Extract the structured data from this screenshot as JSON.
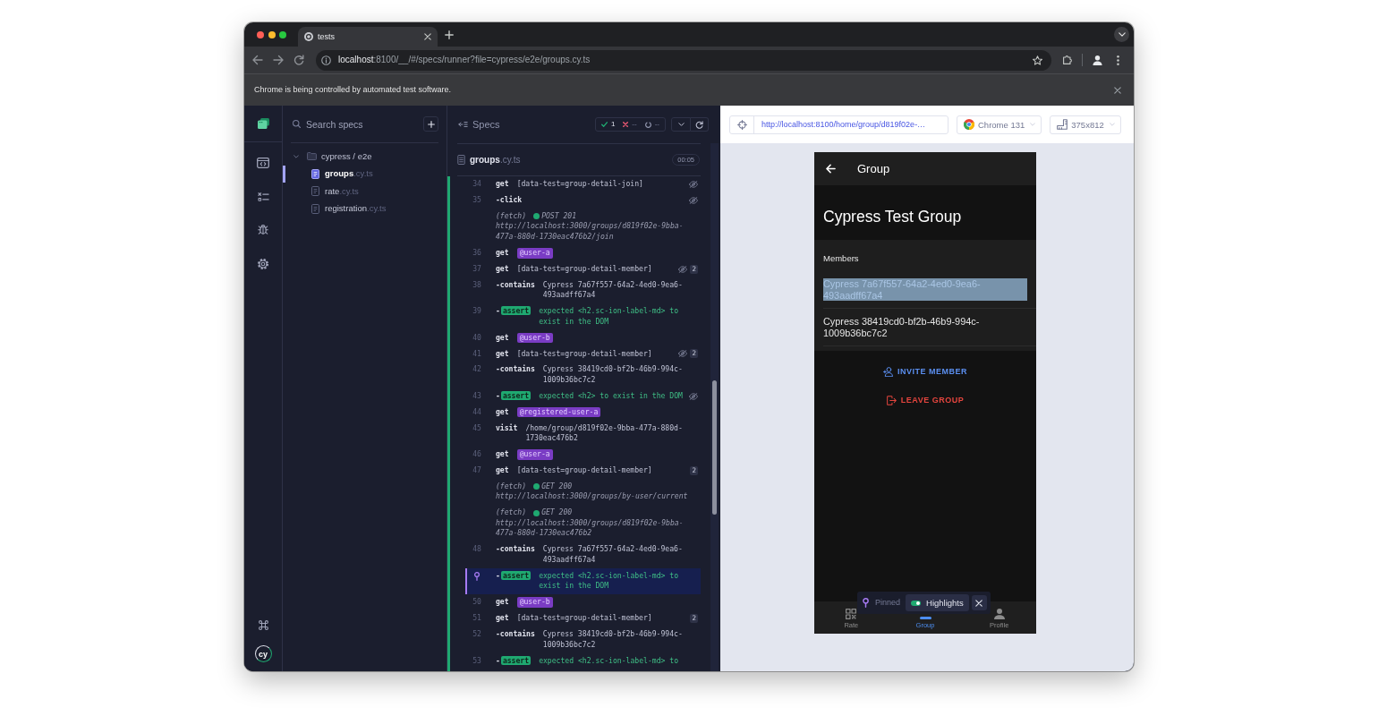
{
  "browser": {
    "tab": {
      "title": "tests",
      "selected": true
    },
    "url": "**localhost**:8100/__/#/specs/runner?file=cypress/e2e/groups.cy.ts",
    "infobar": "Chrome is being controlled by automated test software."
  },
  "nav": {
    "logo_text": "cy"
  },
  "specs": {
    "search": {
      "placeholder": "Search specs"
    },
    "folder": {
      "label": "cypress / e2e",
      "expanded": true,
      "files": [
        {
          "name": "**groups**.cy.ts",
          "selected": true
        },
        {
          "name": "**rate**.cy.ts",
          "selected": false
        },
        {
          "name": "**registration**.cy.ts",
          "selected": false
        }
      ]
    }
  },
  "reporter": {
    "title": "Specs",
    "stats": {
      "passed": "1",
      "failed": "--",
      "pending": "--"
    },
    "file": "**groups**.cy.ts",
    "duration": "00:05",
    "test_passed": true,
    "commands": [
      {
        "line": "34",
        "kind": "command",
        "name": "get",
        "message": "[data-test=group-detail-join]",
        "hidden": true,
        "pinned": false
      },
      {
        "line": "35",
        "kind": "command",
        "name": "-click",
        "hidden": true,
        "pinned": false
      },
      {
        "kind": "fetch",
        "name": "(fetch)",
        "status": "POST 201",
        "message": "http://localhost:3000/groups/d819f02e-9bba-477a-880d-1730eac476b2/join",
        "hidden": false,
        "pinned": false
      },
      {
        "line": "36",
        "kind": "alias",
        "name": "get",
        "message": "@user-a",
        "hidden": false,
        "pinned": false
      },
      {
        "line": "37",
        "kind": "command",
        "name": "get",
        "message": "[data-test=group-detail-member]",
        "hidden": true,
        "count": "2",
        "pinned": false
      },
      {
        "line": "38",
        "kind": "command",
        "name": "-contains",
        "message": "Cypress 7a67f557-64a2-4ed0-9ea6-493aadff67a4",
        "hidden": false,
        "pinned": false
      },
      {
        "line": "39",
        "kind": "assert",
        "name": "-**assert**",
        "message": "expected <h2.sc-ion-label-md> to exist in the DOM",
        "hidden": false,
        "pinned": false
      },
      {
        "line": "40",
        "kind": "alias",
        "name": "get",
        "message": "@user-b",
        "hidden": false,
        "pinned": false
      },
      {
        "line": "41",
        "kind": "command",
        "name": "get",
        "message": "[data-test=group-detail-member]",
        "hidden": true,
        "count": "2",
        "pinned": false
      },
      {
        "line": "42",
        "kind": "command",
        "name": "-contains",
        "message": "Cypress 38419cd0-bf2b-46b9-994c-1009b36bc7c2",
        "hidden": false,
        "pinned": false
      },
      {
        "line": "43",
        "kind": "assert",
        "name": "-**assert**",
        "message": "expected <h2> to exist in the DOM",
        "hidden": true,
        "pinned": false
      },
      {
        "line": "44",
        "kind": "alias",
        "name": "get",
        "message": "@registered-user-a",
        "hidden": false,
        "pinned": false
      },
      {
        "line": "45",
        "kind": "command",
        "name": "visit",
        "message": "/home/group/d819f02e-9bba-477a-880d-1730eac476b2",
        "hidden": false,
        "pinned": false
      },
      {
        "line": "46",
        "kind": "alias",
        "name": "get",
        "message": "@user-a",
        "hidden": false,
        "pinned": false
      },
      {
        "line": "47",
        "kind": "command",
        "name": "get",
        "message": "[data-test=group-detail-member]",
        "hidden": false,
        "count": "2",
        "pinned": false
      },
      {
        "kind": "fetch",
        "name": "(fetch)",
        "status": "GET 200",
        "message": "http://localhost:3000/groups/by-user/current",
        "hidden": false,
        "pinned": false
      },
      {
        "kind": "fetch",
        "name": "(fetch)",
        "status": "GET 200",
        "message": "http://localhost:3000/groups/d819f02e-9bba-477a-880d-1730eac476b2",
        "hidden": false,
        "pinned": false
      },
      {
        "line": "48",
        "kind": "command",
        "name": "-contains",
        "message": "Cypress 7a67f557-64a2-4ed0-9ea6-493aadff67a4",
        "hidden": false,
        "pinned": false
      },
      {
        "kind": "assert",
        "name": "-**assert**",
        "message": "expected <h2.sc-ion-label-md> to exist in the DOM",
        "hidden": false,
        "pinned": true
      },
      {
        "line": "50",
        "kind": "alias",
        "name": "get",
        "message": "@user-b",
        "hidden": false,
        "pinned": false
      },
      {
        "line": "51",
        "kind": "command",
        "name": "get",
        "message": "[data-test=group-detail-member]",
        "hidden": false,
        "count": "2",
        "pinned": false
      },
      {
        "line": "52",
        "kind": "command",
        "name": "-contains",
        "message": "Cypress 38419cd0-bf2b-46b9-994c-1009b36bc7c2",
        "hidden": false,
        "pinned": false
      },
      {
        "line": "53",
        "kind": "assert",
        "name": "-**assert**",
        "message": "expected <h2.sc-ion-label-md> to",
        "hidden": false,
        "pinned": false
      }
    ]
  },
  "preview": {
    "url": "http://localhost:8100/home/group/d819f02e-…",
    "browser": "Chrome 131",
    "viewport": "375x812",
    "app": {
      "title": "Group",
      "group_name": "Cypress Test Group",
      "members_label": "Members",
      "members": [
        {
          "name": "Cypress 7a67f557-64a2-4ed0-9ea6-493aadff67a4",
          "highlighted": true
        },
        {
          "name": "Cypress 38419cd0-bf2b-46b9-994c-1009b36bc7c2",
          "highlighted": false
        }
      ],
      "actions": [
        {
          "label": "INVITE MEMBER",
          "kind": "invite"
        },
        {
          "label": "LEAVE GROUP",
          "kind": "leave"
        }
      ],
      "tabs": [
        {
          "label": "Rate",
          "selected": false
        },
        {
          "label": "Group",
          "selected": true
        },
        {
          "label": "Profile",
          "selected": false
        }
      ]
    },
    "pinned_bar": {
      "label": "Pinned",
      "highlights": {
        "label": "Highlights",
        "on": true
      }
    }
  }
}
